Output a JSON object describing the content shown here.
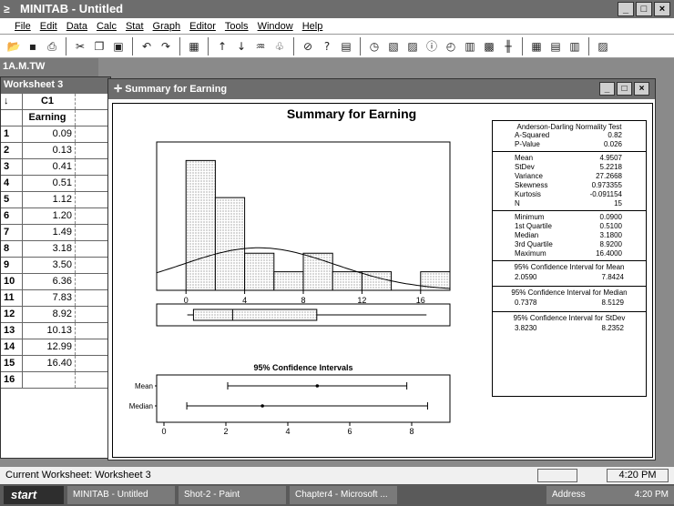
{
  "app": {
    "title": "MINITAB - Untitled",
    "window_buttons": [
      "_",
      "□",
      "×"
    ]
  },
  "menu": [
    "File",
    "Edit",
    "Data",
    "Calc",
    "Stat",
    "Graph",
    "Editor",
    "Tools",
    "Window",
    "Help"
  ],
  "toolbar_icons": [
    "open-icon",
    "save-icon",
    "print-icon",
    "cut-icon",
    "copy-icon",
    "paste-icon",
    "undo-icon",
    "redo-icon",
    "graph-icon",
    "up-icon",
    "down-icon",
    "find-icon",
    "replace-icon",
    "cancel-icon",
    "help-icon",
    "session-icon",
    "info-icon",
    "data-icon",
    "chart-icon",
    "grid-icon",
    "table-icon",
    "layout-icon"
  ],
  "session_label": "1A.M.TW",
  "worksheet": {
    "title": "Worksheet 3",
    "column_id": "C1",
    "column_name": "Earning",
    "rows": [
      {
        "n": "1",
        "v": "0.09"
      },
      {
        "n": "2",
        "v": "0.13"
      },
      {
        "n": "3",
        "v": "0.41"
      },
      {
        "n": "4",
        "v": "0.51"
      },
      {
        "n": "5",
        "v": "1.12"
      },
      {
        "n": "6",
        "v": "1.20"
      },
      {
        "n": "7",
        "v": "1.49"
      },
      {
        "n": "8",
        "v": "3.18"
      },
      {
        "n": "9",
        "v": "3.50"
      },
      {
        "n": "10",
        "v": "6.36"
      },
      {
        "n": "11",
        "v": "7.83"
      },
      {
        "n": "12",
        "v": "8.92"
      },
      {
        "n": "13",
        "v": "10.13"
      },
      {
        "n": "14",
        "v": "12.99"
      },
      {
        "n": "15",
        "v": "16.40"
      },
      {
        "n": "16",
        "v": ""
      }
    ]
  },
  "graph_window": {
    "title": "Summary for Earning",
    "chart_title": "Summary for Earning",
    "buttons": [
      "_",
      "□",
      "×"
    ]
  },
  "chart_data": [
    {
      "type": "bar",
      "title": "Summary for Earning",
      "bin_edges": [
        0,
        2,
        4,
        6,
        8,
        10,
        12,
        14,
        16,
        18
      ],
      "values": [
        7,
        5,
        2,
        1,
        2,
        1,
        1,
        0,
        1
      ],
      "xticks": [
        0,
        4,
        8,
        12,
        16
      ],
      "xlim": [
        -2,
        18
      ],
      "ylim": [
        0,
        8
      ],
      "overlay": "normal curve",
      "grid": false
    },
    {
      "type": "boxplot",
      "min": 0.09,
      "q1": 0.51,
      "median": 3.18,
      "q3": 8.92,
      "max": 16.4,
      "xlim": [
        -2,
        18
      ]
    },
    {
      "type": "interval",
      "title": "95% Confidence Intervals",
      "categories": [
        "Mean",
        "Median"
      ],
      "series": [
        {
          "name": "Mean",
          "low": 2.059,
          "point": 4.9507,
          "high": 7.8424
        },
        {
          "name": "Median",
          "low": 0.7378,
          "point": 3.18,
          "high": 8.5129
        }
      ],
      "xticks": [
        0,
        2,
        4,
        6,
        8
      ],
      "xlim": [
        0,
        9
      ]
    }
  ],
  "stats_panel": {
    "ad_title": "Anderson-Darling Normality Test",
    "ad": [
      {
        "k": "A-Squared",
        "v": "0.82"
      },
      {
        "k": "P-Value",
        "v": "0.026"
      }
    ],
    "moments": [
      {
        "k": "Mean",
        "v": "4.9507"
      },
      {
        "k": "StDev",
        "v": "5.2218"
      },
      {
        "k": "Variance",
        "v": "27.2668"
      },
      {
        "k": "Skewness",
        "v": "0.973355"
      },
      {
        "k": "Kurtosis",
        "v": "-0.091154"
      },
      {
        "k": "N",
        "v": "15"
      }
    ],
    "quartiles": [
      {
        "k": "Minimum",
        "v": "0.0900"
      },
      {
        "k": "1st Quartile",
        "v": "0.5100"
      },
      {
        "k": "Median",
        "v": "3.1800"
      },
      {
        "k": "3rd Quartile",
        "v": "8.9200"
      },
      {
        "k": "Maximum",
        "v": "16.4000"
      }
    ],
    "ci_mean_label": "95% Confidence Interval for Mean",
    "ci_mean": [
      "2.0590",
      "7.8424"
    ],
    "ci_median_label": "95% Confidence Interval for Median",
    "ci_median": [
      "0.7378",
      "8.5129"
    ],
    "ci_stdev_label": "95% Confidence Interval for StDev",
    "ci_stdev": [
      "3.8230",
      "8.2352"
    ]
  },
  "status": {
    "text": "Current Worksheet: Worksheet 3",
    "clock": "4:20 PM"
  },
  "taskbar": {
    "start": "start",
    "tasks": [
      "MINITAB - Untitled",
      "Shot-2 - Paint",
      "Chapter4 - Microsoft ..."
    ],
    "address": "Address",
    "time": "4:20 PM"
  }
}
